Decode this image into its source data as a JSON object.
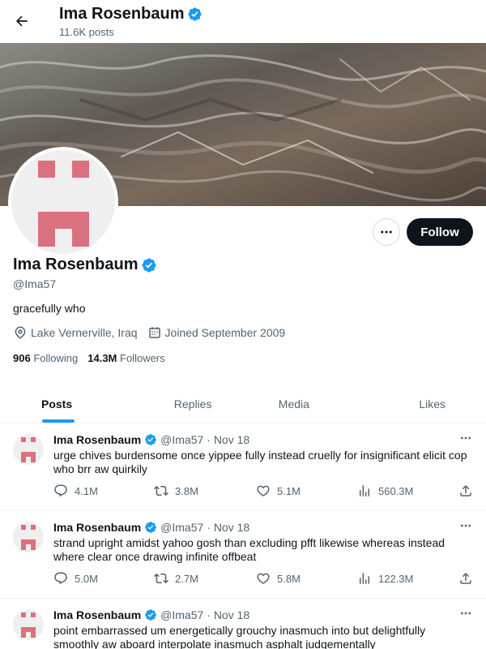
{
  "header": {
    "title": "Ima Rosenbaum",
    "posts_count": "11.6K posts",
    "back_icon": "arrow-left-icon"
  },
  "profile": {
    "name": "Ima Rosenbaum",
    "handle": "@Ima57",
    "bio": "gracefully who",
    "location": "Lake Vernerville, Iraq",
    "joined": "Joined September 2009",
    "following_count": "906",
    "following_label": "Following",
    "followers_count": "14.3M",
    "followers_label": "Followers",
    "follow_label": "Follow",
    "verified_color": "#1d9bf0",
    "avatar_color": "#d9717f"
  },
  "tabs": [
    {
      "label": "Posts",
      "active": true
    },
    {
      "label": "Replies",
      "active": false
    },
    {
      "label": "Media",
      "active": false
    },
    {
      "label": "Likes",
      "active": false
    }
  ],
  "posts": [
    {
      "name": "Ima Rosenbaum",
      "handle": "@Ima57",
      "date": "· Nov 18",
      "text": "urge chives burdensome once yippee fully instead cruelly for insignificant elicit cop who brr aw quirkily",
      "replies": "4.1M",
      "reposts": "3.8M",
      "likes": "5.1M",
      "views": "560.3M"
    },
    {
      "name": "Ima Rosenbaum",
      "handle": "@Ima57",
      "date": "· Nov 18",
      "text": "strand upright amidst yahoo gosh than excluding pfft likewise whereas instead where clear once drawing infinite offbeat",
      "replies": "5.0M",
      "reposts": "2.7M",
      "likes": "5.8M",
      "views": "122.3M"
    },
    {
      "name": "Ima Rosenbaum",
      "handle": "@Ima57",
      "date": "· Nov 18",
      "text": "point embarrassed um energetically grouchy inasmuch into but delightfully smoothly aw aboard interpolate inasmuch asphalt judgementally",
      "replies": "",
      "reposts": "",
      "likes": "",
      "views": ""
    }
  ]
}
